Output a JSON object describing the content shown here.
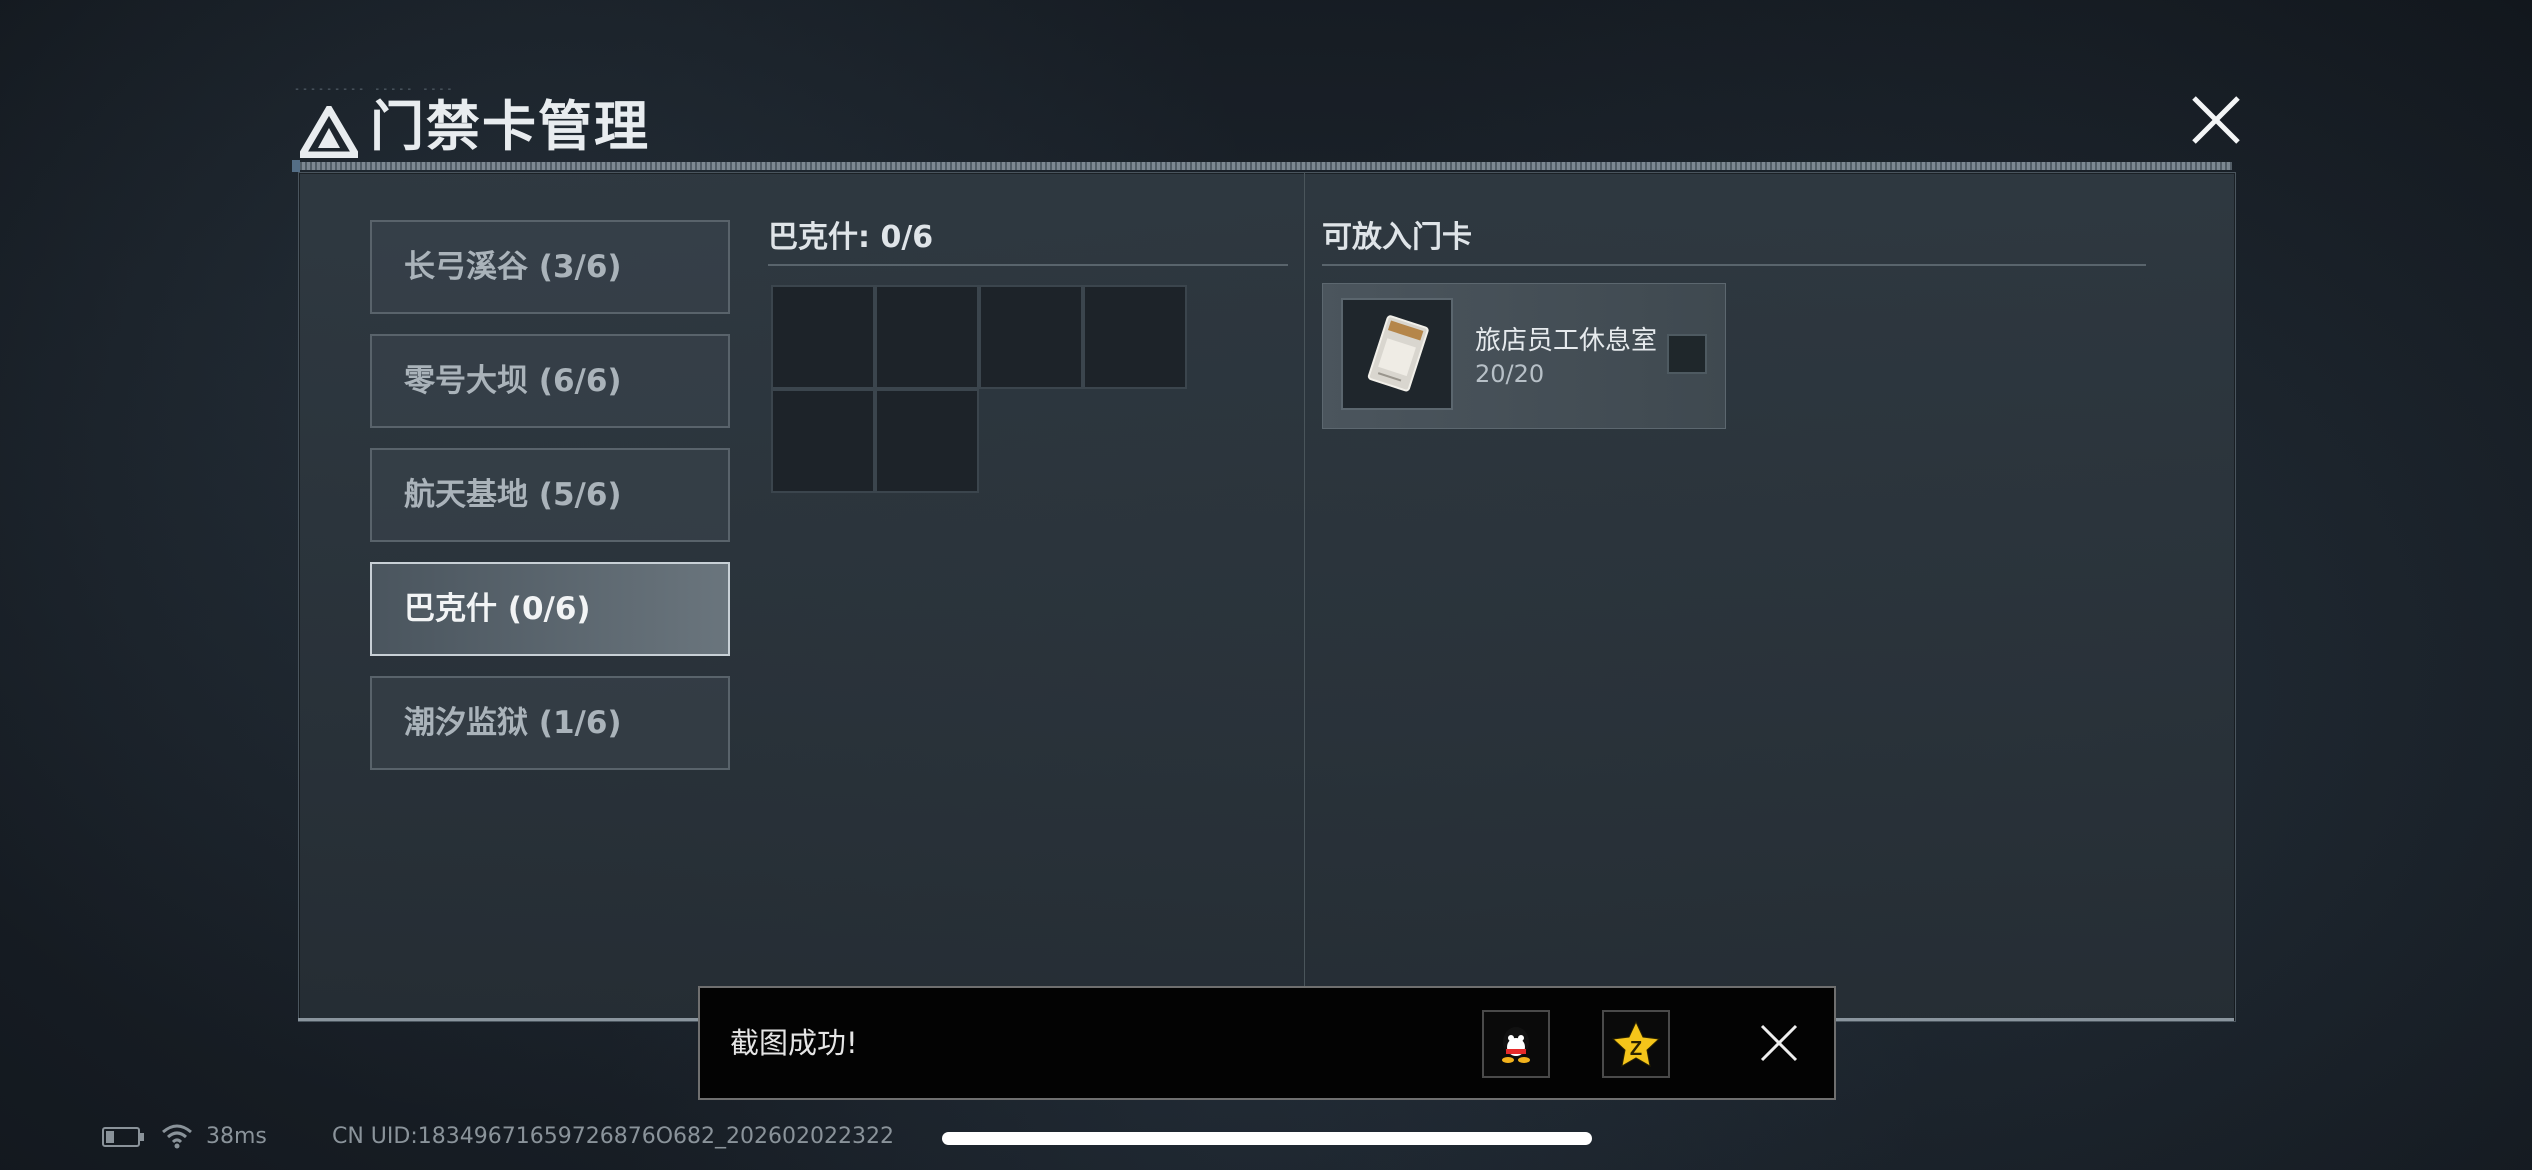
{
  "window": {
    "title": "门禁卡管理",
    "header_tag": "--------- ----- ----"
  },
  "maps": [
    {
      "label": "长弓溪谷 (3/6)",
      "active": false
    },
    {
      "label": "零号大坝 (6/6)",
      "active": false
    },
    {
      "label": "航天基地 (5/6)",
      "active": false
    },
    {
      "label": "巴克什 (0/6)",
      "active": true
    },
    {
      "label": "潮汐监狱 (1/6)",
      "active": false
    }
  ],
  "slots": {
    "title": "巴克什: 0/6",
    "count": 6
  },
  "available": {
    "title": "可放入门卡",
    "cards": [
      {
        "name": "旅店员工休息室",
        "count": "20/20",
        "checked": false
      }
    ]
  },
  "toast": {
    "message": "截图成功!",
    "icons": [
      "qq-icon",
      "qzone-icon"
    ]
  },
  "status": {
    "ping": "38ms",
    "uid": "CN UID:18349671659726876O682_202602022322"
  },
  "colors": {
    "panel": "#2f3942",
    "active_item": "#5d6870",
    "toast_bg": "#030303"
  }
}
